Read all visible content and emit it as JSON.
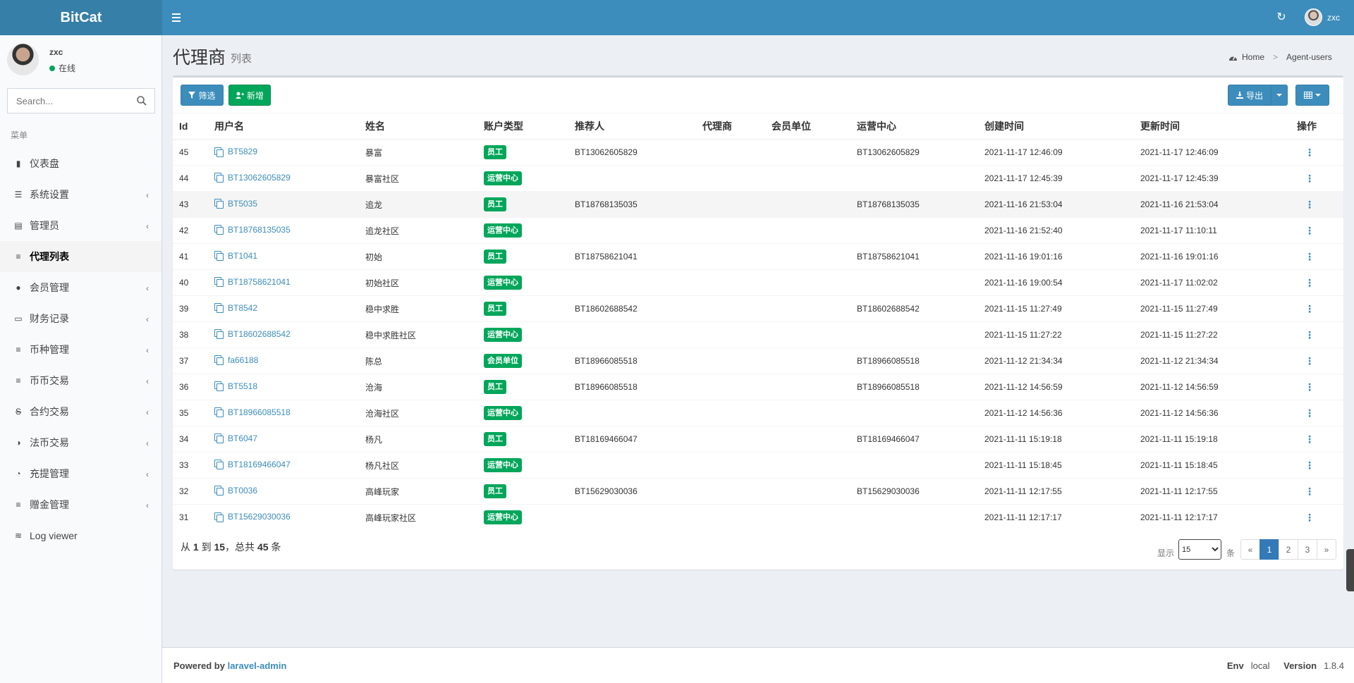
{
  "app": {
    "logo": "BitCat"
  },
  "header": {
    "user_name": "zxc"
  },
  "sidebar": {
    "user": {
      "name": "zxc",
      "status": "在线"
    },
    "search_placeholder": "Search...",
    "menu_header": "菜单",
    "items": [
      {
        "label": "仪表盘",
        "icon": "bar-chart-icon",
        "has_children": false,
        "active": false
      },
      {
        "label": "系统设置",
        "icon": "sliders-icon",
        "has_children": true,
        "active": false
      },
      {
        "label": "管理员",
        "icon": "server-icon",
        "has_children": true,
        "active": false
      },
      {
        "label": "代理列表",
        "icon": "list-icon",
        "has_children": false,
        "active": true
      },
      {
        "label": "会员管理",
        "icon": "users-icon",
        "has_children": true,
        "active": false
      },
      {
        "label": "财务记录",
        "icon": "money-icon",
        "has_children": true,
        "active": false
      },
      {
        "label": "币种管理",
        "icon": "list-icon",
        "has_children": true,
        "active": false
      },
      {
        "label": "币币交易",
        "icon": "list-icon",
        "has_children": true,
        "active": false
      },
      {
        "label": "合约交易",
        "icon": "strikethrough-icon",
        "has_children": true,
        "active": false
      },
      {
        "label": "法币交易",
        "icon": "adjust-icon",
        "has_children": true,
        "active": false
      },
      {
        "label": "充提管理",
        "icon": "dashboard-icon",
        "has_children": true,
        "active": false
      },
      {
        "label": "赠金管理",
        "icon": "list-icon",
        "has_children": true,
        "active": false
      },
      {
        "label": "Log viewer",
        "icon": "database-icon",
        "has_children": false,
        "active": false
      }
    ]
  },
  "page": {
    "title": "代理商",
    "subtitle": "列表",
    "breadcrumb": {
      "home": "Home",
      "current": "Agent-users"
    }
  },
  "toolbar": {
    "filter_label": "筛选",
    "add_label": "新增",
    "export_label": "导出"
  },
  "table": {
    "columns": [
      "Id",
      "用户名",
      "姓名",
      "账户类型",
      "推荐人",
      "代理商",
      "会员单位",
      "运营中心",
      "创建时间",
      "更新时间",
      "操作"
    ],
    "rows": [
      {
        "id": "45",
        "username": "BT5829",
        "name": "暴富",
        "type": "员工",
        "referrer": "BT13062605829",
        "agent": "",
        "member_unit": "",
        "ops_center": "BT13062605829",
        "created": "2021-11-17 12:46:09",
        "updated": "2021-11-17 12:46:09"
      },
      {
        "id": "44",
        "username": "BT13062605829",
        "name": "暴富社区",
        "type": "运营中心",
        "referrer": "",
        "agent": "",
        "member_unit": "",
        "ops_center": "",
        "created": "2021-11-17 12:45:39",
        "updated": "2021-11-17 12:45:39"
      },
      {
        "id": "43",
        "username": "BT5035",
        "name": "追龙",
        "type": "员工",
        "referrer": "BT18768135035",
        "agent": "",
        "member_unit": "",
        "ops_center": "BT18768135035",
        "created": "2021-11-16 21:53:04",
        "updated": "2021-11-16 21:53:04"
      },
      {
        "id": "42",
        "username": "BT18768135035",
        "name": "追龙社区",
        "type": "运营中心",
        "referrer": "",
        "agent": "",
        "member_unit": "",
        "ops_center": "",
        "created": "2021-11-16 21:52:40",
        "updated": "2021-11-17 11:10:11"
      },
      {
        "id": "41",
        "username": "BT1041",
        "name": "初始",
        "type": "员工",
        "referrer": "BT18758621041",
        "agent": "",
        "member_unit": "",
        "ops_center": "BT18758621041",
        "created": "2021-11-16 19:01:16",
        "updated": "2021-11-16 19:01:16"
      },
      {
        "id": "40",
        "username": "BT18758621041",
        "name": "初始社区",
        "type": "运营中心",
        "referrer": "",
        "agent": "",
        "member_unit": "",
        "ops_center": "",
        "created": "2021-11-16 19:00:54",
        "updated": "2021-11-17 11:02:02"
      },
      {
        "id": "39",
        "username": "BT8542",
        "name": "稳中求胜",
        "type": "员工",
        "referrer": "BT18602688542",
        "agent": "",
        "member_unit": "",
        "ops_center": "BT18602688542",
        "created": "2021-11-15 11:27:49",
        "updated": "2021-11-15 11:27:49"
      },
      {
        "id": "38",
        "username": "BT18602688542",
        "name": "稳中求胜社区",
        "type": "运营中心",
        "referrer": "",
        "agent": "",
        "member_unit": "",
        "ops_center": "",
        "created": "2021-11-15 11:27:22",
        "updated": "2021-11-15 11:27:22"
      },
      {
        "id": "37",
        "username": "fa66188",
        "name": "陈总",
        "type": "会员单位",
        "referrer": "BT18966085518",
        "agent": "",
        "member_unit": "",
        "ops_center": "BT18966085518",
        "created": "2021-11-12 21:34:34",
        "updated": "2021-11-12 21:34:34"
      },
      {
        "id": "36",
        "username": "BT5518",
        "name": "沧海",
        "type": "员工",
        "referrer": "BT18966085518",
        "agent": "",
        "member_unit": "",
        "ops_center": "BT18966085518",
        "created": "2021-11-12 14:56:59",
        "updated": "2021-11-12 14:56:59"
      },
      {
        "id": "35",
        "username": "BT18966085518",
        "name": "沧海社区",
        "type": "运营中心",
        "referrer": "",
        "agent": "",
        "member_unit": "",
        "ops_center": "",
        "created": "2021-11-12 14:56:36",
        "updated": "2021-11-12 14:56:36"
      },
      {
        "id": "34",
        "username": "BT6047",
        "name": "杨凡",
        "type": "员工",
        "referrer": "BT18169466047",
        "agent": "",
        "member_unit": "",
        "ops_center": "BT18169466047",
        "created": "2021-11-11 15:19:18",
        "updated": "2021-11-11 15:19:18"
      },
      {
        "id": "33",
        "username": "BT18169466047",
        "name": "杨凡社区",
        "type": "运营中心",
        "referrer": "",
        "agent": "",
        "member_unit": "",
        "ops_center": "",
        "created": "2021-11-11 15:18:45",
        "updated": "2021-11-11 15:18:45"
      },
      {
        "id": "32",
        "username": "BT0036",
        "name": "高峰玩家",
        "type": "员工",
        "referrer": "BT15629030036",
        "agent": "",
        "member_unit": "",
        "ops_center": "BT15629030036",
        "created": "2021-11-11 12:17:55",
        "updated": "2021-11-11 12:17:55"
      },
      {
        "id": "31",
        "username": "BT15629030036",
        "name": "高峰玩家社区",
        "type": "运营中心",
        "referrer": "",
        "agent": "",
        "member_unit": "",
        "ops_center": "",
        "created": "2021-11-11 12:17:17",
        "updated": "2021-11-11 12:17:17"
      }
    ],
    "action_glyph": "⋮"
  },
  "pagination": {
    "summary_prefix": "从",
    "from": "1",
    "to_word": "到",
    "to": "15",
    "total_prefix": "，总共",
    "total": "45",
    "unit": "条",
    "show_label": "显示",
    "per_page": "15",
    "per_page_unit": "条",
    "prev": "«",
    "pages": [
      "1",
      "2",
      "3"
    ],
    "current_page": "1",
    "next": "»"
  },
  "footer": {
    "powered_by": "Powered by",
    "link_text": "laravel-admin",
    "env_label": "Env",
    "env_value": "local",
    "version_label": "Version",
    "version_value": "1.8.4"
  },
  "colors": {
    "header": "#3c8dbc",
    "logo_bg": "#367fa9",
    "success": "#00a65a",
    "primary": "#3c8dbc"
  }
}
